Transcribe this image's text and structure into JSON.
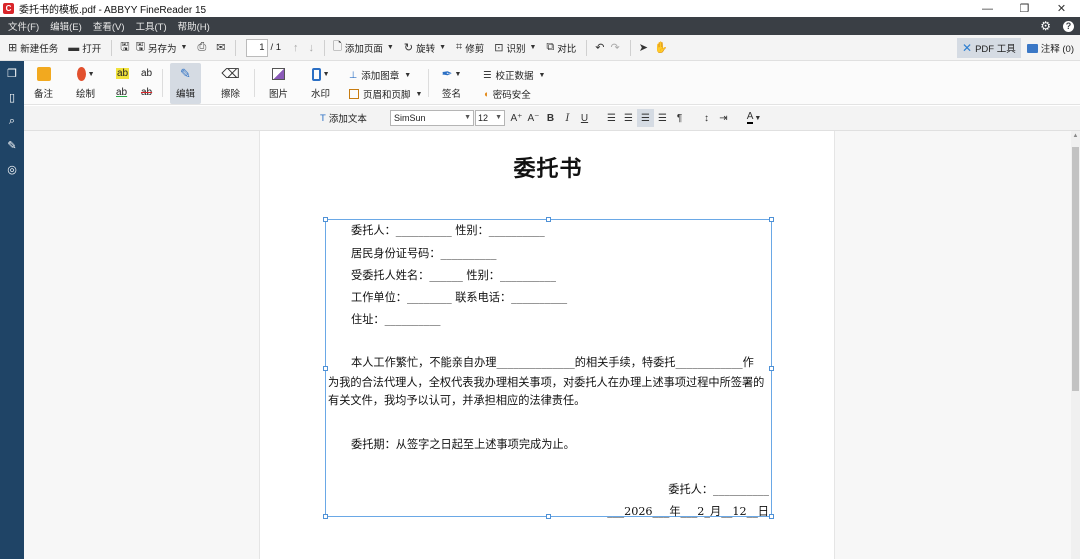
{
  "window": {
    "title": "委托书的模板.pdf - ABBYY FineReader 15",
    "controls": {
      "minimize": "—",
      "restore": "❐",
      "close": "✕"
    }
  },
  "menu": {
    "items": [
      "文件(F)",
      "编辑(E)",
      "查看(V)",
      "工具(T)",
      "帮助(H)"
    ],
    "settings_icon": "gear-icon",
    "help_icon": "help-icon"
  },
  "toolbar": {
    "new_task": "新建任务",
    "open": "打开",
    "save_as": "另存为",
    "page_current": "1",
    "page_total": "/ 1",
    "add_page": "添加页面",
    "rotate": "旋转",
    "crop": "修剪",
    "recognize": "识别",
    "compare": "对比",
    "pdf_tools": "PDF 工具",
    "annotations": "注释 (0)"
  },
  "ribbon": {
    "note": "备注",
    "draw": "绘制",
    "edit": "编辑",
    "erase": "擦除",
    "image": "图片",
    "watermark": "水印",
    "add_stamp": "添加图章",
    "header_footer": "页眉和页脚",
    "sign": "签名",
    "redact_data": "校正数据",
    "password": "密码安全",
    "hl_text": "ab"
  },
  "format_bar": {
    "add_text": "添加文本",
    "font": "SimSun",
    "size": "12",
    "grow": "A⁺",
    "shrink": "A⁻",
    "bold": "B",
    "italic": "I",
    "underline": "U"
  },
  "document": {
    "title": "委托书",
    "lines": [
      "委托人：__________     性别：__________",
      "居民身份证号码：__________",
      "受委托人姓名：______          性别：__________",
      "工作单位：________     联系电话：__________",
      "住址：__________",
      "本人工作繁忙，不能亲自办理______________的相关手续，特委托____________作",
      "为我的合法代理人，全权代表我办理相关事项，对委托人在办理上述事项过程中所签署的",
      "有关文件，我均予以认可，并承担相应的法律责任。",
      "委托期：从签字之日起至上述事项完成为止。",
      "委托人：__________",
      "___2026___年___2_月__12__日"
    ]
  }
}
